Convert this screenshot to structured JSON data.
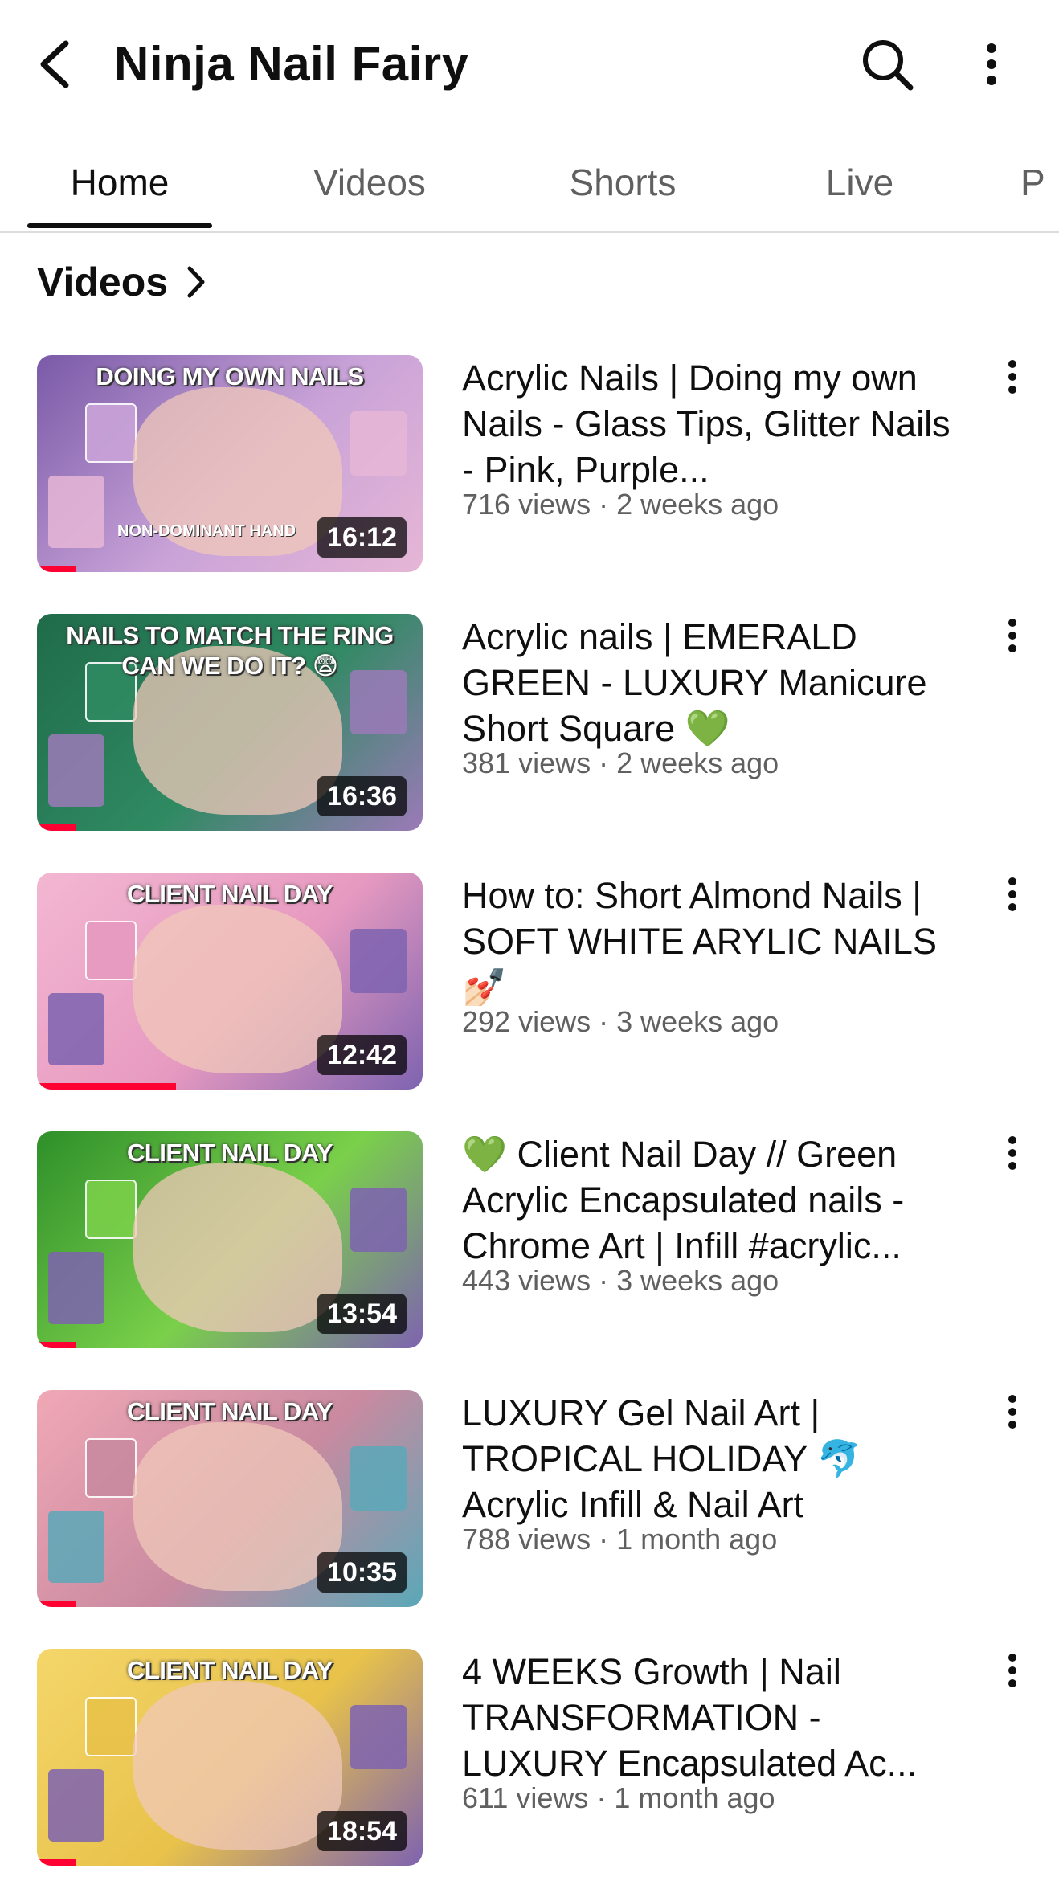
{
  "header": {
    "channel_name": "Ninja Nail Fairy",
    "back_icon": "arrow-back-icon",
    "search_icon": "search-icon",
    "more_icon": "more-vert-icon"
  },
  "tabs": [
    {
      "label": "Home",
      "active": true
    },
    {
      "label": "Videos",
      "active": false
    },
    {
      "label": "Shorts",
      "active": false
    },
    {
      "label": "Live",
      "active": false
    },
    {
      "label": "P",
      "active": false
    }
  ],
  "section": {
    "title": "Videos",
    "chevron_icon": "chevron-right-icon"
  },
  "videos": [
    {
      "title": "Acrylic Nails | Doing my own Nails - Glass Tips, Glitter Nails - Pink, Purple...",
      "stats": "716 views · 2 weeks ago",
      "duration": "16:12",
      "thumb_caption": "DOING MY OWN NAILS",
      "thumb_subcaption": "NON-DOMINANT HAND",
      "watched_fraction": 0.1,
      "colors": [
        "#7a5aa8",
        "#c9a3d8",
        "#e6b6d6"
      ]
    },
    {
      "title": "Acrylic nails | EMERALD GREEN - LUXURY Manicure Short Square 💚",
      "stats": "381 views · 2 weeks ago",
      "duration": "16:36",
      "thumb_caption": "NAILS TO MATCH THE RING CAN WE DO IT? 😨",
      "thumb_subcaption": "",
      "watched_fraction": 0.1,
      "colors": [
        "#1f6b4a",
        "#2f8a62",
        "#9b7ab8"
      ]
    },
    {
      "title": "How to: Short Almond Nails | SOFT WHITE ARYLIC NAILS 💅🏻",
      "stats": "292 views · 3 weeks ago",
      "duration": "12:42",
      "thumb_caption": "CLIENT NAIL DAY",
      "thumb_subcaption": "",
      "watched_fraction": 0.36,
      "colors": [
        "#f3b7d2",
        "#e79ac0",
        "#7e63b0"
      ]
    },
    {
      "title": "💚 Client Nail Day // Green Acrylic Encapsulated nails - Chrome Art | Infill #acrylic...",
      "stats": "443 views · 3 weeks ago",
      "duration": "13:54",
      "thumb_caption": "CLIENT NAIL DAY",
      "thumb_subcaption": "",
      "watched_fraction": 0.1,
      "colors": [
        "#2e8f2a",
        "#7ad04a",
        "#7e63b0"
      ]
    },
    {
      "title": "LUXURY Gel Nail Art | TROPICAL HOLIDAY 🐬 Acrylic Infill & Nail Art",
      "stats": "788 views · 1 month ago",
      "duration": "10:35",
      "thumb_caption": "CLIENT NAIL DAY",
      "thumb_subcaption": "",
      "watched_fraction": 0.1,
      "colors": [
        "#f0a8b6",
        "#c98aa0",
        "#5aa8b8"
      ]
    },
    {
      "title": "4 WEEKS Growth | Nail TRANSFORMATION - LUXURY Encapsulated Ac...",
      "stats": "611 views · 1 month ago",
      "duration": "18:54",
      "thumb_caption": "CLIENT NAIL DAY",
      "thumb_subcaption": "",
      "watched_fraction": 0.1,
      "colors": [
        "#f4d66a",
        "#e8c24a",
        "#7e63b0"
      ]
    }
  ]
}
